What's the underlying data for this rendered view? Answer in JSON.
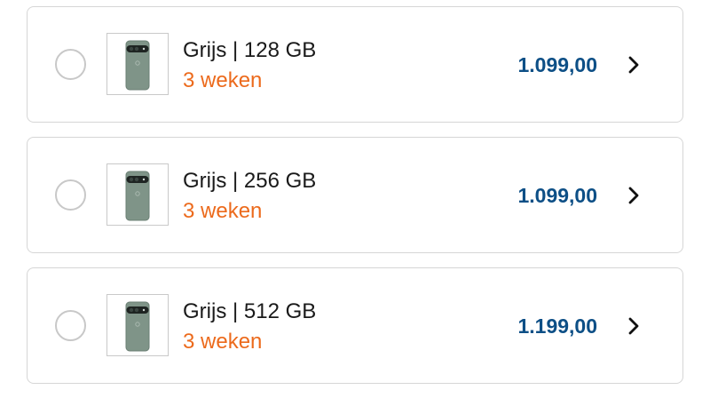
{
  "options": [
    {
      "variant": "Grijs | 128 GB",
      "delivery": "3 weken",
      "price": "1.099,00",
      "image_icon": "phone-thumbnail-icon",
      "chevron_icon": "chevron-right-icon",
      "selected": false
    },
    {
      "variant": "Grijs | 256 GB",
      "delivery": "3 weken",
      "price": "1.099,00",
      "image_icon": "phone-thumbnail-icon",
      "chevron_icon": "chevron-right-icon",
      "selected": false
    },
    {
      "variant": "Grijs | 512 GB",
      "delivery": "3 weken",
      "price": "1.199,00",
      "image_icon": "phone-thumbnail-icon",
      "chevron_icon": "chevron-right-icon",
      "selected": false
    }
  ],
  "colors": {
    "delivery_text": "#ec6a1c",
    "price_text": "#0d4f86",
    "card_border": "#d6d6d6",
    "phone_body": "#7f9488"
  }
}
